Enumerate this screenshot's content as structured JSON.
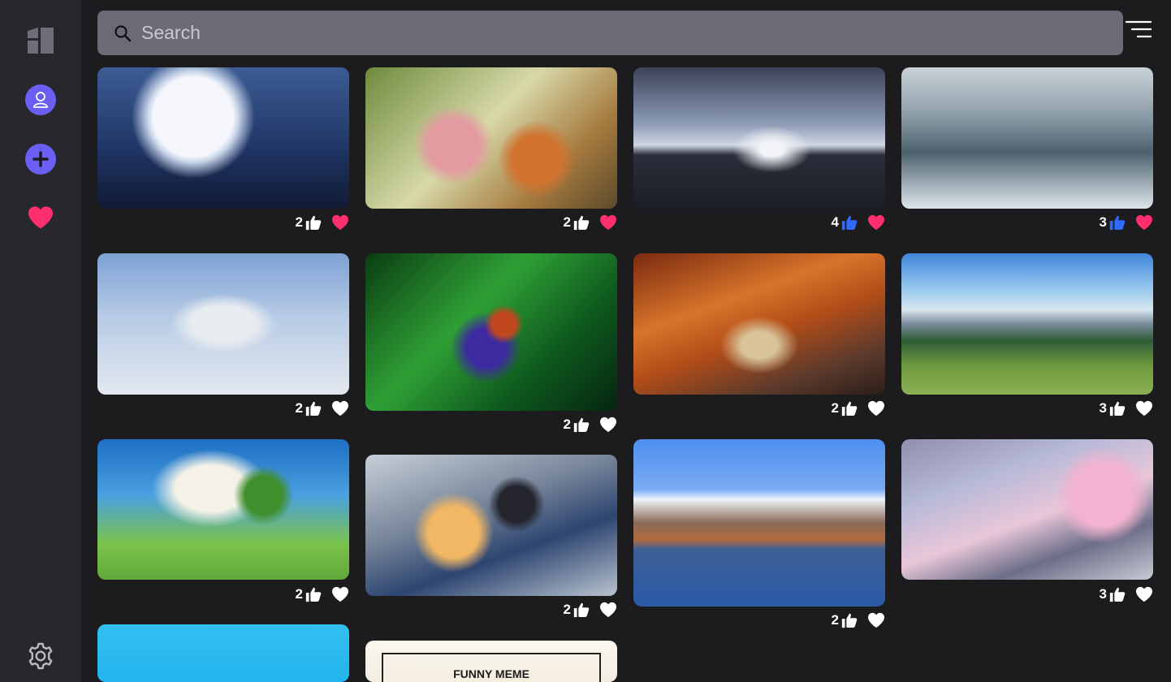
{
  "sidebar": {
    "logo": "gallery-logo-icon",
    "items": [
      {
        "name": "profile",
        "icon": "user-icon"
      },
      {
        "name": "add",
        "icon": "plus-icon"
      },
      {
        "name": "favorites",
        "icon": "heart-icon"
      },
      {
        "name": "settings",
        "icon": "gear-icon"
      }
    ]
  },
  "search": {
    "placeholder": "Search",
    "value": ""
  },
  "colors": {
    "accent": "#6b5ef5",
    "liked_heart": "#ff2e6e",
    "liked_thumb": "#2f6bff",
    "background": "#1c1c1f",
    "sidebar": "#28282c",
    "search_bg": "#6b6b77"
  },
  "cards": [
    {
      "id": 1,
      "subject": "moon-silhouette",
      "likes": "2",
      "thumb_active": false,
      "favorited": true
    },
    {
      "id": 2,
      "subject": "anime-popsicles",
      "likes": "2",
      "thumb_active": false,
      "favorited": true
    },
    {
      "id": 3,
      "subject": "palm-sunset",
      "likes": "4",
      "thumb_active": true,
      "favorited": true
    },
    {
      "id": 4,
      "subject": "snowy-gazebo",
      "likes": "3",
      "thumb_active": true,
      "favorited": true
    },
    {
      "id": 5,
      "subject": "sketch-boy-sky",
      "likes": "2",
      "thumb_active": false,
      "favorited": false
    },
    {
      "id": 6,
      "subject": "jungle-bird",
      "likes": "2",
      "thumb_active": false,
      "favorited": false
    },
    {
      "id": 7,
      "subject": "autumn-road",
      "likes": "2",
      "thumb_active": false,
      "favorited": false
    },
    {
      "id": 8,
      "subject": "mountain-village",
      "likes": "3",
      "thumb_active": false,
      "favorited": false
    },
    {
      "id": 9,
      "subject": "green-meadow",
      "likes": "2",
      "thumb_active": false,
      "favorited": false
    },
    {
      "id": 10,
      "subject": "winter-couple",
      "likes": "2",
      "thumb_active": false,
      "favorited": false
    },
    {
      "id": 11,
      "subject": "mount-fuji-lake",
      "likes": "2",
      "thumb_active": false,
      "favorited": false
    },
    {
      "id": 12,
      "subject": "cherry-crossing",
      "likes": "3",
      "thumb_active": false,
      "favorited": false
    },
    {
      "id": 13,
      "subject": "blue-sky",
      "likes": "",
      "thumb_active": false,
      "favorited": false
    },
    {
      "id": 14,
      "subject": "funny-meme",
      "caption": "FUNNY MEME",
      "likes": "",
      "thumb_active": false,
      "favorited": false
    }
  ]
}
